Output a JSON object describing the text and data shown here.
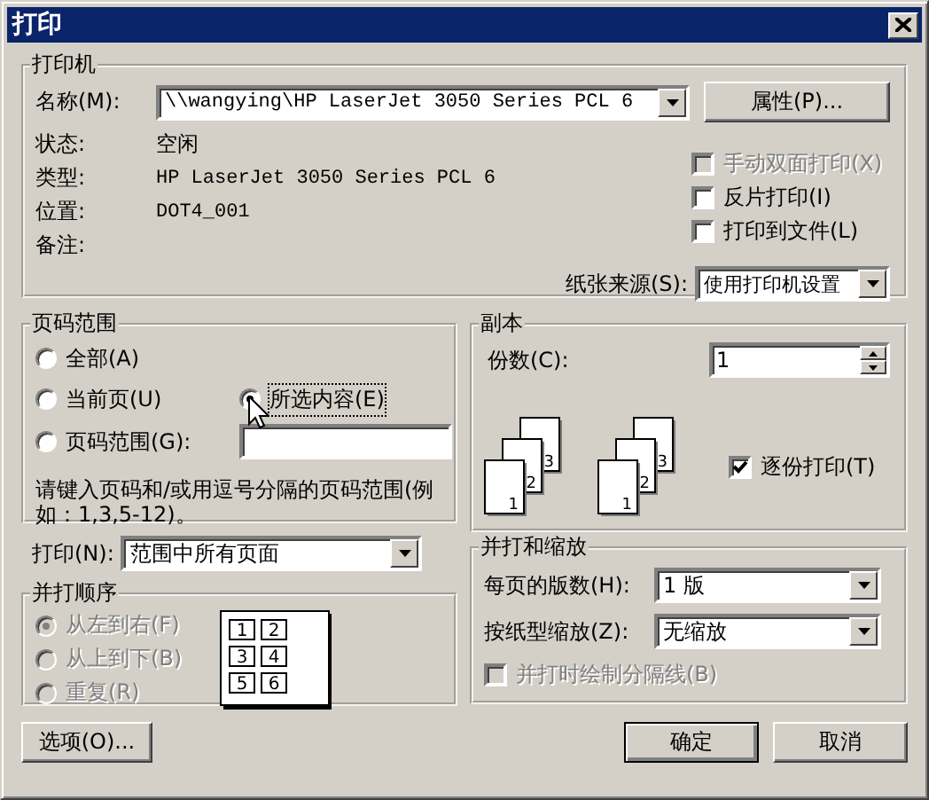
{
  "window": {
    "title": "打印"
  },
  "printer": {
    "legend": "打印机",
    "name_label": "名称(M):",
    "name_value": "\\\\wangying\\HP LaserJet 3050 Series PCL 6",
    "properties_button": "属性(P)...",
    "info": [
      {
        "label": "状态:",
        "value": "空闲",
        "mono": false
      },
      {
        "label": "类型:",
        "value": "HP LaserJet 3050 Series PCL 6",
        "mono": true
      },
      {
        "label": "位置:",
        "value": "DOT4_001",
        "mono": true
      },
      {
        "label": "备注:"
      }
    ],
    "options": [
      {
        "label": "手动双面打印(X)",
        "checked": false,
        "disabled": true
      },
      {
        "label": "反片打印(I)",
        "checked": false,
        "disabled": false
      },
      {
        "label": "打印到文件(L)",
        "checked": false,
        "disabled": false
      }
    ],
    "paper_source_label": "纸张来源(S):",
    "paper_source_value": "使用打印机设置"
  },
  "page_range": {
    "legend": "页码范围",
    "options": [
      {
        "label": "全部(A)",
        "selected": false
      },
      {
        "label": "当前页(U)",
        "selected": false
      },
      {
        "label": "所选内容(E)",
        "selected": true
      },
      {
        "label": "页码范围(G):",
        "selected": false
      }
    ],
    "hint": "请键入页码和/或用逗号分隔的页码范围(例如：1,3,5-12)。"
  },
  "copies": {
    "legend": "副本",
    "count_label": "份数(C):",
    "count_value": "1",
    "stacks": [
      [
        "1",
        "2",
        "3"
      ],
      [
        "1",
        "2",
        "3"
      ]
    ],
    "collate": {
      "label": "逐份打印(T)",
      "checked": true
    }
  },
  "print_what": {
    "label": "打印(N):",
    "value": "范围中所有页面"
  },
  "order": {
    "legend": "并打顺序",
    "options": [
      {
        "label": "从左到右(F)",
        "selected": true,
        "disabled": true
      },
      {
        "label": "从上到下(B)",
        "selected": false,
        "disabled": true
      },
      {
        "label": "重复(R)",
        "selected": false,
        "disabled": true
      }
    ],
    "pages": [
      "1",
      "2",
      "3",
      "4",
      "5",
      "6"
    ]
  },
  "zoom": {
    "legend": "并打和缩放",
    "rows": [
      {
        "label": "每页的版数(H):",
        "value": "1 版"
      },
      {
        "label": "按纸型缩放(Z):",
        "value": "无缩放"
      }
    ],
    "separator": {
      "label": "并打时绘制分隔线(B)",
      "checked": false,
      "disabled": true
    }
  },
  "buttons": {
    "options": "选项(O)...",
    "ok": "确定",
    "cancel": "取消"
  }
}
